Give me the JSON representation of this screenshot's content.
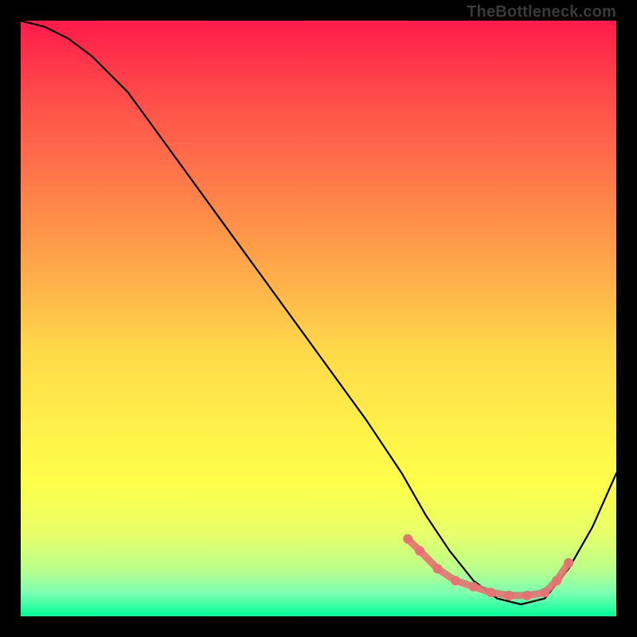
{
  "watermark": "TheBottleneck.com",
  "chart_data": {
    "type": "line",
    "title": "",
    "xlabel": "",
    "ylabel": "",
    "xlim": [
      0,
      100
    ],
    "ylim": [
      0,
      100
    ],
    "grid": false,
    "legend": false,
    "series": [
      {
        "name": "curve",
        "color": "#000000",
        "x": [
          0,
          4,
          8,
          12,
          18,
          26,
          34,
          42,
          50,
          58,
          64,
          68,
          72,
          76,
          80,
          84,
          88,
          92,
          96,
          100
        ],
        "y": [
          100,
          99,
          97,
          94,
          88,
          77,
          66,
          55,
          44,
          33,
          24,
          17,
          11,
          6,
          3,
          2,
          3,
          8,
          15,
          24
        ]
      }
    ],
    "markers": [
      {
        "name": "flat-region-dots",
        "color": "#e57373",
        "x": [
          65,
          67,
          70,
          73,
          76,
          79,
          82,
          85,
          88,
          90,
          92
        ],
        "y": [
          13,
          11,
          8,
          6,
          5,
          4,
          3.5,
          3.5,
          4,
          6,
          9
        ]
      }
    ]
  }
}
